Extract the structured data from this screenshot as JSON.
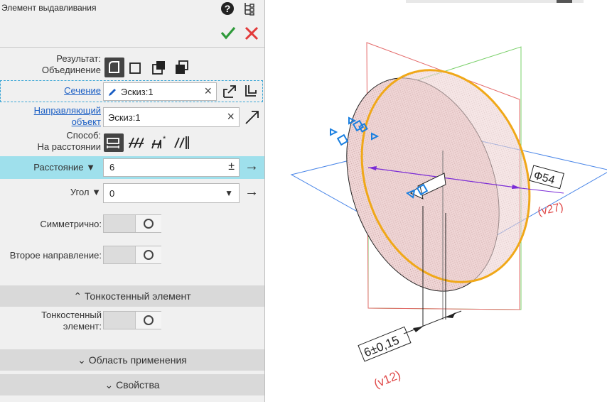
{
  "panel": {
    "title": "Элемент выдавливания",
    "result_label_1": "Результат:",
    "result_label_2": "Объединение",
    "section_label": "Сечение",
    "section_value": "Эскиз:1",
    "guide_label_1": "Направляющий",
    "guide_label_2": "объект",
    "guide_value": "Эскиз:1",
    "method_label_1": "Способ:",
    "method_label_2": "На расстоянии",
    "distance_label": "Расстояние",
    "distance_value": "6",
    "distance_pm": "±",
    "angle_label": "Угол",
    "angle_value": "0",
    "symmetric_label": "Симметрично:",
    "second_dir_label": "Второе направление:",
    "thin_section": "Тонкостенный элемент",
    "thin_label_1": "Тонкостенный",
    "thin_label_2": "элемент:",
    "scope_section": "Область применения",
    "props_section": "Свойства"
  },
  "viewport": {
    "diameter_label": "Ф54",
    "v27_label": "(v27)",
    "dim_label": "6±0,15",
    "v12_label": "(v12)"
  }
}
